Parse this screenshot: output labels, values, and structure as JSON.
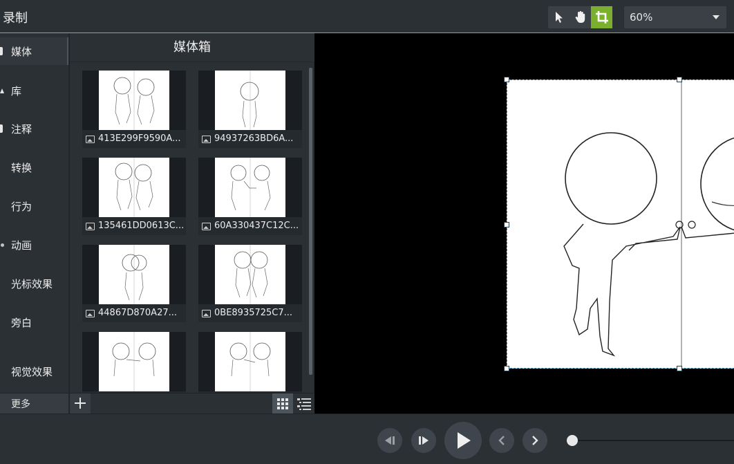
{
  "app": {
    "title": "录制"
  },
  "toolbar": {
    "tools": [
      {
        "name": "select-tool",
        "icon": "pointer-arrow-icon",
        "active": false
      },
      {
        "name": "pan-tool",
        "icon": "hand-icon",
        "active": false
      },
      {
        "name": "crop-tool",
        "icon": "crop-icon",
        "active": true
      }
    ],
    "zoom": {
      "value": "60%"
    },
    "accent": "#7ab02c"
  },
  "sidebar": {
    "items": [
      {
        "label": "媒体",
        "active": true
      },
      {
        "label": "库",
        "active": false
      },
      {
        "label": "注释",
        "active": false
      },
      {
        "label": "转换",
        "active": false
      },
      {
        "label": "行为",
        "active": false
      },
      {
        "label": "动画",
        "active": false
      },
      {
        "label": "光标效果",
        "active": false
      },
      {
        "label": "旁白",
        "active": false
      },
      {
        "label": "视觉效果",
        "active": false
      }
    ],
    "more_label": "更多"
  },
  "media_bin": {
    "title": "媒体箱",
    "items": [
      {
        "name": "413E299F9590A...",
        "icon": "image-icon"
      },
      {
        "name": "94937263BD6A...",
        "icon": "image-icon"
      },
      {
        "name": "135461DD0613C...",
        "icon": "image-icon"
      },
      {
        "name": "60A330437C12C...",
        "icon": "image-icon"
      },
      {
        "name": "44867D870A27...",
        "icon": "image-icon"
      },
      {
        "name": "0BE8935725C7...",
        "icon": "image-icon"
      },
      {
        "name": "",
        "icon": "image-icon"
      },
      {
        "name": "",
        "icon": "image-icon"
      }
    ],
    "view_mode": "grid"
  },
  "playback": {
    "controls": [
      "step-back-icon",
      "step-forward-icon",
      "play-icon",
      "previous-icon",
      "next-icon"
    ]
  }
}
